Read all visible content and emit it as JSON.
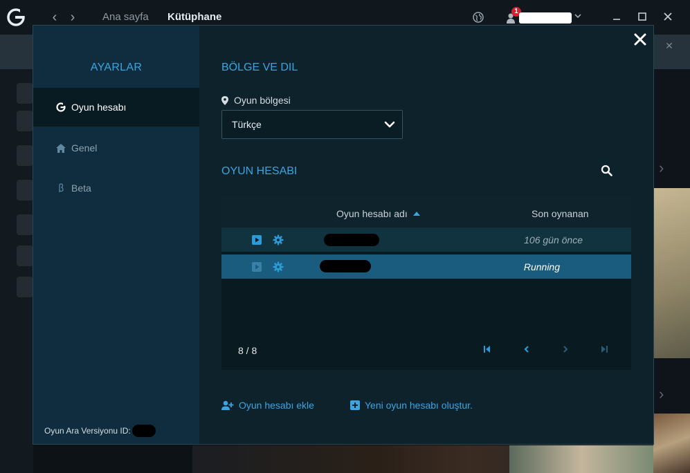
{
  "topbar": {
    "nav_home": "Ana sayfa",
    "nav_library": "Kütüphane",
    "notification_count": "1"
  },
  "settings": {
    "title": "AYARLAR",
    "menu": [
      {
        "label": "Oyun hesabı",
        "icon": "g-logo-icon",
        "active": true
      },
      {
        "label": "Genel",
        "icon": "home-icon",
        "active": false
      },
      {
        "label": "Beta",
        "icon": "beta-icon",
        "active": false
      }
    ],
    "version_label": "Oyun Ara Versiyonu ID:"
  },
  "region": {
    "section_title": "BÖLGE VE DIL",
    "label": "Oyun bölgesi",
    "selected": "Türkçe"
  },
  "accounts": {
    "section_title": "OYUN HESABI",
    "columns": {
      "name": "Oyun hesabı adı",
      "last_played": "Son oynanan"
    },
    "rows": [
      {
        "last_played": "106 gün önce",
        "selected": false
      },
      {
        "last_played": "Running",
        "selected": true
      }
    ],
    "page_count": "8 / 8",
    "add_account": "Oyun hesabı ekle",
    "create_account": "Yeni oyun hesabı oluştur."
  },
  "colors": {
    "accent": "#3ba5df",
    "selected_row": "#1a5c7e",
    "sidebar": "#0f2d3e",
    "modal_bg": "#0e222c"
  }
}
